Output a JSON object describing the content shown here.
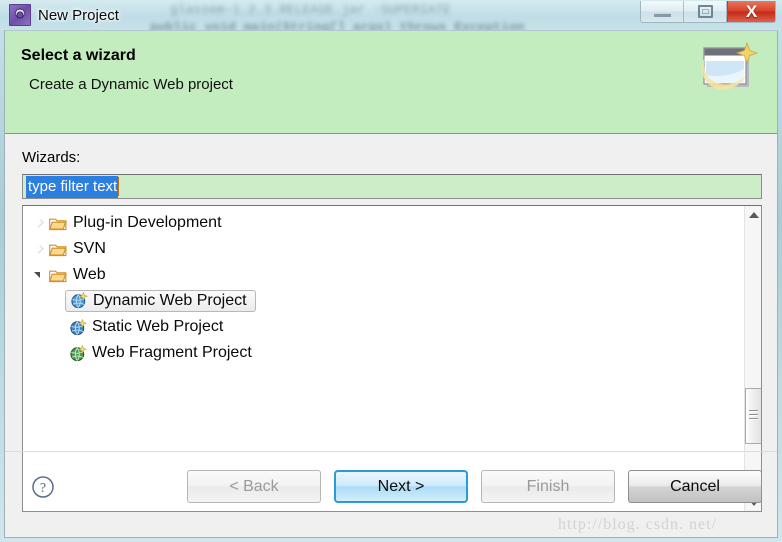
{
  "window": {
    "title": "New Project",
    "app_icon": "gear-icon",
    "controls": {
      "minimize": "minimize-icon",
      "maximize": "maximize-icon",
      "close": "X"
    }
  },
  "header": {
    "title": "Select a wizard",
    "description": "Create a Dynamic Web project",
    "icon": "new-window-sparkle-icon",
    "bg_color": "#c4edbf"
  },
  "content": {
    "wizards_label": "Wizards:",
    "filter": {
      "value": "type filter text",
      "placeholder": "type filter text",
      "selected": true,
      "bg_color": "#cdecc8",
      "selection_color": "#2a7fe0"
    },
    "tree": [
      {
        "label": "Plug-in Development",
        "level": 1,
        "icon": "folder-icon",
        "state": "collapsed",
        "selected": false
      },
      {
        "label": "SVN",
        "level": 1,
        "icon": "folder-icon",
        "state": "collapsed",
        "selected": false
      },
      {
        "label": "Web",
        "level": 1,
        "icon": "folder-icon",
        "state": "expanded",
        "selected": false
      },
      {
        "label": "Dynamic Web Project",
        "level": 2,
        "icon": "globe-sparkle-icon",
        "state": "leaf",
        "selected": true
      },
      {
        "label": "Static Web Project",
        "level": 2,
        "icon": "globe-sparkle-icon",
        "state": "leaf",
        "selected": false
      },
      {
        "label": "Web Fragment Project",
        "level": 2,
        "icon": "globe-sparkle-icon",
        "state": "leaf",
        "selected": false
      }
    ],
    "scrollbar": {
      "up_arrow": "scroll-up-icon",
      "down_arrow": "scroll-down-icon"
    }
  },
  "footer": {
    "help_icon": "help-question-icon",
    "buttons": [
      {
        "label": "< Back",
        "state": "disabled"
      },
      {
        "label": "Next >",
        "state": "default"
      },
      {
        "label": "Finish",
        "state": "disabled"
      },
      {
        "label": "Cancel",
        "state": "hover"
      }
    ]
  },
  "watermark": "http://blog. csdn. net/",
  "backdrop": {
    "code_lines": [
      "glassem-1.2.3.RELEASE.jar  -SUPERIATE",
      "public void  main(String[] args)  throws  Exception"
    ]
  }
}
